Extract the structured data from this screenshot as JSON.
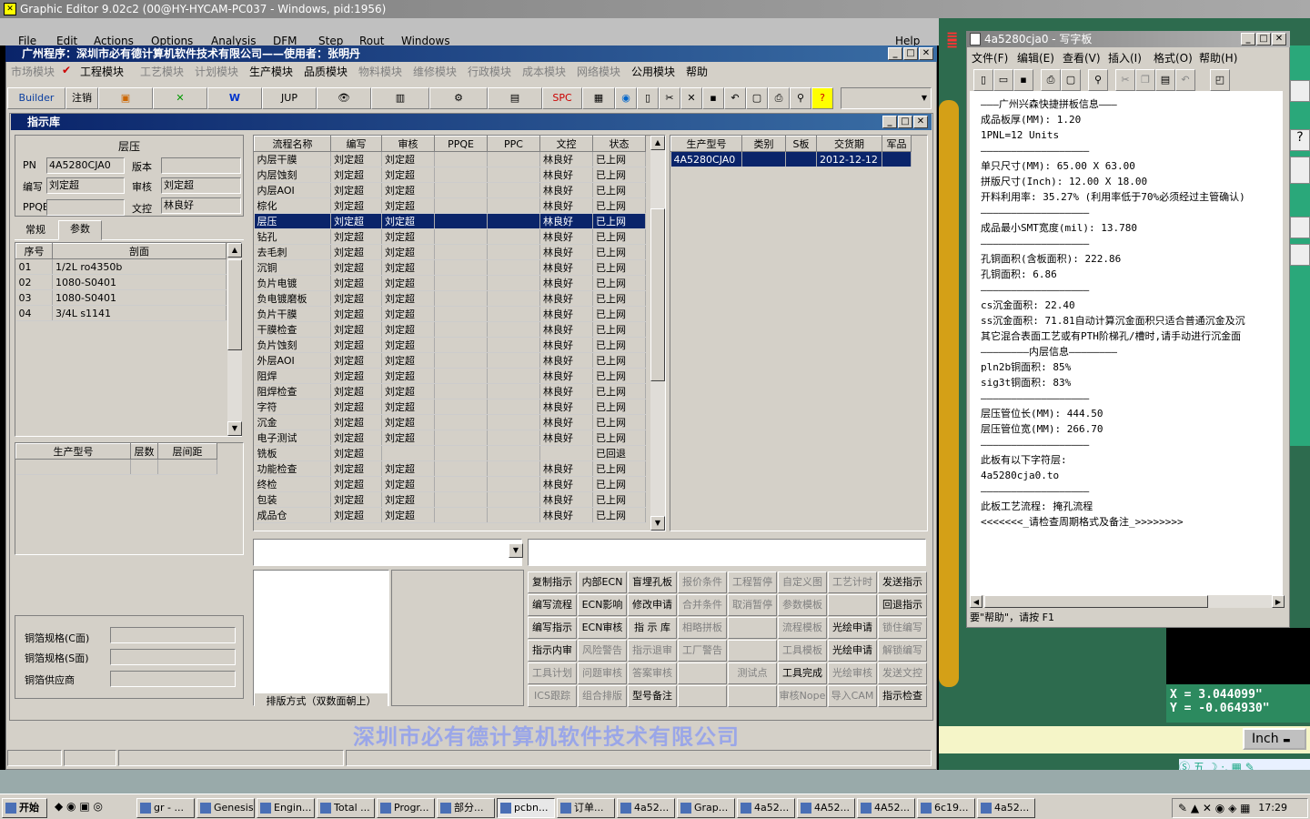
{
  "ge": {
    "title": "Graphic Editor 9.02c2 (00@HY-HYCAM-PC037 - Windows, pid:1956)",
    "menu": [
      "File",
      "Edit",
      "Actions",
      "Options",
      "Analysis",
      "DFM",
      "Step",
      "Rout",
      "Windows",
      "Help"
    ],
    "coord_x": "X = 3.044099\"",
    "coord_y": "Y = -0.064930\"",
    "units": "Inch"
  },
  "main": {
    "title": "广州程序：深圳市必有德计算机软件技术有限公司——使用者：张明丹",
    "menu": [
      "市场模块",
      "工程模块",
      "工艺模块",
      "计划模块",
      "生产模块",
      "品质模块",
      "物料模块",
      "维修模块",
      "行政模块",
      "成本模块",
      "网络模块",
      "公用模块",
      "帮助"
    ],
    "toolbar": {
      "builder": "Builder",
      "logout": "注销",
      "jup": "JUP",
      "spc": "SPC"
    },
    "watermark": "深圳市必有德计算机软件技术有限公司"
  },
  "panel": {
    "title": "指示库",
    "section": "层压",
    "fields": {
      "pn_label": "PN",
      "pn": "4A5280CJA0",
      "version_label": "版本",
      "version": "",
      "writer_label": "编写",
      "writer": "刘定超",
      "review_label": "审核",
      "review": "刘定超",
      "ppqe_label": "PPQE",
      "ppqe": "",
      "doc_label": "文控",
      "doc": "林良好"
    },
    "tabs": [
      "常规",
      "参数"
    ],
    "stack_headers": [
      "序号",
      "剖面"
    ],
    "stack_rows": [
      [
        "01",
        "1/2L ro4350b"
      ],
      [
        "02",
        "1080-S0401"
      ],
      [
        "03",
        "1080-S0401"
      ],
      [
        "04",
        "3/4L s1141"
      ]
    ],
    "model_headers": [
      "生产型号",
      "层数",
      "层间距"
    ],
    "copper": {
      "c_label": "铜箔规格(C面)",
      "s_label": "铜箔规格(S面)",
      "supplier_label": "铜箔供应商"
    },
    "flow_headers": [
      "流程名称",
      "编写",
      "审核",
      "PPQE",
      "PPC",
      "文控",
      "状态"
    ],
    "flow_rows": [
      [
        "内层干膜",
        "刘定超",
        "刘定超",
        "",
        "",
        "林良好",
        "已上网"
      ],
      [
        "内层蚀刻",
        "刘定超",
        "刘定超",
        "",
        "",
        "林良好",
        "已上网"
      ],
      [
        "内层AOI",
        "刘定超",
        "刘定超",
        "",
        "",
        "林良好",
        "已上网"
      ],
      [
        "棕化",
        "刘定超",
        "刘定超",
        "",
        "",
        "林良好",
        "已上网"
      ],
      [
        "层压",
        "刘定超",
        "刘定超",
        "",
        "",
        "林良好",
        "已上网"
      ],
      [
        "钻孔",
        "刘定超",
        "刘定超",
        "",
        "",
        "林良好",
        "已上网"
      ],
      [
        "去毛刺",
        "刘定超",
        "刘定超",
        "",
        "",
        "林良好",
        "已上网"
      ],
      [
        "沉铜",
        "刘定超",
        "刘定超",
        "",
        "",
        "林良好",
        "已上网"
      ],
      [
        "负片电镀",
        "刘定超",
        "刘定超",
        "",
        "",
        "林良好",
        "已上网"
      ],
      [
        "负电镀磨板",
        "刘定超",
        "刘定超",
        "",
        "",
        "林良好",
        "已上网"
      ],
      [
        "负片干膜",
        "刘定超",
        "刘定超",
        "",
        "",
        "林良好",
        "已上网"
      ],
      [
        "干膜检查",
        "刘定超",
        "刘定超",
        "",
        "",
        "林良好",
        "已上网"
      ],
      [
        "负片蚀刻",
        "刘定超",
        "刘定超",
        "",
        "",
        "林良好",
        "已上网"
      ],
      [
        "外层AOI",
        "刘定超",
        "刘定超",
        "",
        "",
        "林良好",
        "已上网"
      ],
      [
        "阻焊",
        "刘定超",
        "刘定超",
        "",
        "",
        "林良好",
        "已上网"
      ],
      [
        "阻焊检查",
        "刘定超",
        "刘定超",
        "",
        "",
        "林良好",
        "已上网"
      ],
      [
        "字符",
        "刘定超",
        "刘定超",
        "",
        "",
        "林良好",
        "已上网"
      ],
      [
        "沉金",
        "刘定超",
        "刘定超",
        "",
        "",
        "林良好",
        "已上网"
      ],
      [
        "电子测试",
        "刘定超",
        "刘定超",
        "",
        "",
        "林良好",
        "已上网"
      ],
      [
        "铣板",
        "刘定超",
        "",
        "",
        "",
        "",
        "已回退"
      ],
      [
        "功能检查",
        "刘定超",
        "刘定超",
        "",
        "",
        "林良好",
        "已上网"
      ],
      [
        "终检",
        "刘定超",
        "刘定超",
        "",
        "",
        "林良好",
        "已上网"
      ],
      [
        "包装",
        "刘定超",
        "刘定超",
        "",
        "",
        "林良好",
        "已上网"
      ],
      [
        "成品仓",
        "刘定超",
        "刘定超",
        "",
        "",
        "林良好",
        "已上网"
      ]
    ],
    "selected_flow": 4,
    "order_headers": [
      "生产型号",
      "类别",
      "S板",
      "交货期",
      "军品"
    ],
    "order_rows": [
      [
        "4A5280CJA0",
        "",
        "",
        "2012-12-12",
        ""
      ]
    ],
    "layout_label": "排版方式（双数面朝上）",
    "actions": [
      [
        "复制指示",
        "内部ECN",
        "盲埋孔板",
        "报价条件",
        "工程暂停",
        "自定义图",
        "工艺计时",
        "发送指示"
      ],
      [
        "编写流程",
        "ECN影响",
        "修改申请",
        "合并条件",
        "取消暂停",
        "参数模板",
        "",
        "回退指示"
      ],
      [
        "编写指示",
        "ECN审核",
        "指 示 库",
        "相略拼板",
        "",
        "流程模板",
        "光绘申请",
        "锁住编写"
      ],
      [
        "指示内审",
        "风险警告",
        "指示退审",
        "工厂警告",
        "",
        "工具模板",
        "光绘申请",
        "解锁编写"
      ],
      [
        "工具计划",
        "问题审核",
        "答案审核",
        "",
        "测试点",
        "工具完成",
        "光绘审核",
        "发送文控"
      ],
      [
        "ICS跟踪",
        "组合排版",
        "型号备注",
        "",
        "",
        "审核Nope",
        "导入CAM",
        "指示检查"
      ]
    ],
    "actions_disabled": [
      [
        false,
        false,
        false,
        true,
        true,
        true,
        true,
        false
      ],
      [
        false,
        false,
        false,
        true,
        true,
        true,
        false,
        false
      ],
      [
        false,
        false,
        false,
        true,
        false,
        true,
        false,
        true
      ],
      [
        false,
        true,
        true,
        true,
        false,
        true,
        false,
        true
      ],
      [
        true,
        true,
        true,
        false,
        true,
        false,
        true,
        true
      ],
      [
        true,
        true,
        false,
        false,
        false,
        true,
        true,
        false
      ]
    ]
  },
  "notepad": {
    "title": "4a5280cja0 - 写字板",
    "menu": [
      "文件(F)",
      "编辑(E)",
      "查看(V)",
      "插入(I)",
      "格式(O)",
      "帮助(H)"
    ],
    "lines": [
      "———广州兴森快捷拼板信息———",
      "成品板厚(MM): 1.20",
      "1PNL=12 Units",
      "——————————————————",
      "单只尺寸(MM): 65.00 X 63.00",
      "拼版尺寸(Inch): 12.00 X 18.00",
      "开料利用率: 35.27% (利用率低于70%必须经过主管确认)",
      "——————————————————",
      "成品最小SMT宽度(mil): 13.780",
      "——————————————————",
      "孔铜面积(含板面积): 222.86",
      "孔铜面积: 6.86",
      "——————————————————",
      "cs沉金面积: 22.40",
      "ss沉金面积: 71.81自动计算沉金面积只适合普通沉金及沉",
      "其它混合表面工艺或有PTH阶梯孔/槽时,请手动进行沉金面",
      "————————内层信息————————",
      "pln2b铜面积: 85%",
      "sig3t铜面积: 83%",
      "——————————————————",
      "层压管位长(MM): 444.50",
      "层压管位宽(MM): 266.70",
      "——————————————————",
      "此板有以下字符层:",
      "4a5280cja0.to",
      "——————————————————",
      "此板工艺流程: 掩孔流程",
      "<<<<<<<_请检查周期格式及备注_>>>>>>>>"
    ],
    "status": "要\"帮助\"，请按 F1"
  },
  "taskbar": {
    "start": "开始",
    "items": [
      "gr - ...",
      "Genesis",
      "Engin...",
      "Total ...",
      "Progr...",
      "部分...",
      "pcbn...",
      "订单...",
      "4a52...",
      "Grap...",
      "4a52...",
      "4A52...",
      "4A52...",
      "6c19...",
      "4a52..."
    ],
    "active": 6,
    "clock": "17:29"
  }
}
